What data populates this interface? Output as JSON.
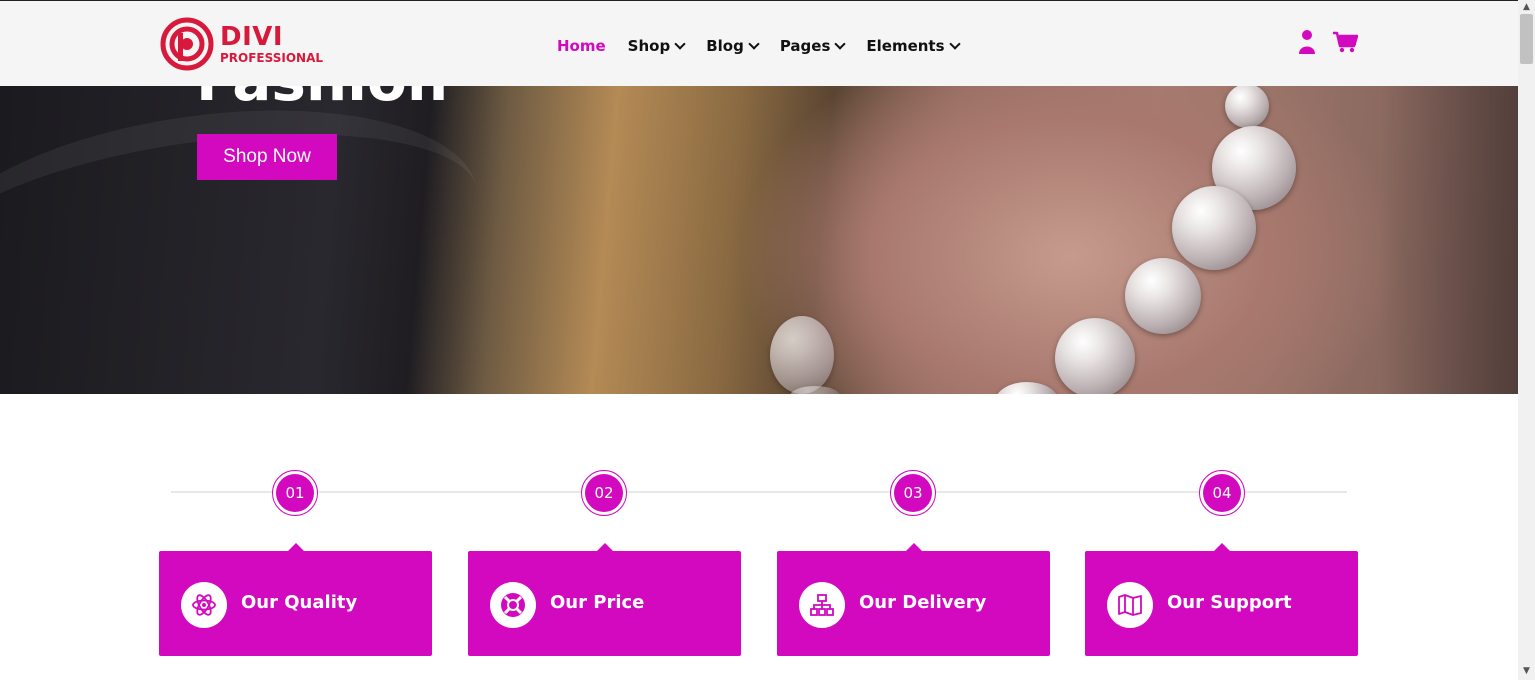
{
  "brand": {
    "name_line1": "DIVI",
    "name_line2": "PROFESSIONAL"
  },
  "nav": {
    "items": [
      {
        "label": "Home",
        "active": true,
        "dropdown": false
      },
      {
        "label": "Shop",
        "active": false,
        "dropdown": true
      },
      {
        "label": "Blog",
        "active": false,
        "dropdown": true
      },
      {
        "label": "Pages",
        "active": false,
        "dropdown": true
      },
      {
        "label": "Elements",
        "active": false,
        "dropdown": true
      }
    ]
  },
  "header_icons": {
    "user": "user-icon",
    "cart": "cart-icon"
  },
  "hero": {
    "heading": "Fashion",
    "cta_label": "Shop Now"
  },
  "steps": [
    "01",
    "02",
    "03",
    "04"
  ],
  "cards": [
    {
      "title": "Our Quality",
      "icon": "atom-icon"
    },
    {
      "title": "Our Price",
      "icon": "lifebuoy-icon"
    },
    {
      "title": "Our Delivery",
      "icon": "sitemap-icon"
    },
    {
      "title": "Our Support",
      "icon": "map-icon"
    }
  ],
  "colors": {
    "accent": "#d209be",
    "logo": "#d7193b",
    "header_bg": "#f5f5f5"
  }
}
